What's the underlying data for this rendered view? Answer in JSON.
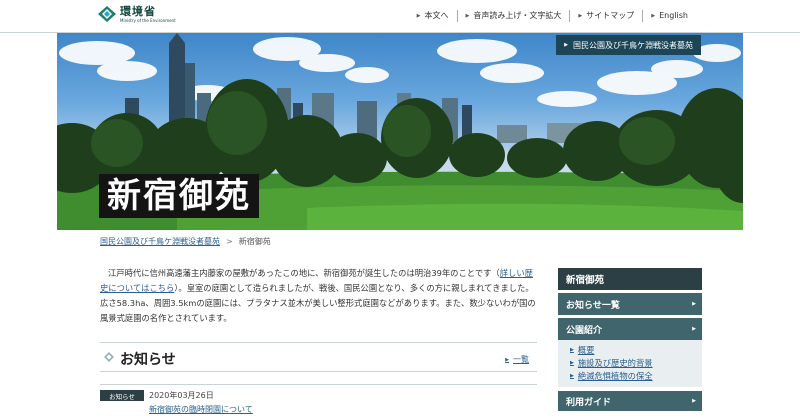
{
  "header": {
    "logo_jp": "環境省",
    "logo_en": "Ministry of the Environment",
    "util_nav": [
      "本文へ",
      "音声読み上げ・文字拡大",
      "サイトマップ",
      "English"
    ]
  },
  "hero": {
    "badge": "国民公園及び千鳥ケ淵戦没者墓苑",
    "title": "新宿御苑"
  },
  "breadcrumb": {
    "parent": "国民公園及び千鳥ケ淵戦没者墓苑",
    "current": "新宿御苑"
  },
  "intro": {
    "text_before": "江戸時代に信州高遠藩主内藤家の屋敷があったこの地に、新宿御苑が誕生したのは明治39年のことです（",
    "link": "詳しい歴史についてはこちら",
    "text_after": "）。皇室の庭園として造られましたが、戦後、国民公園となり、多くの方に親しまれてきました。広さ58.3ha、周囲3.5kmの庭園には、プラタナス並木が美しい整形式庭園などがあります。また、数少ないわが国の風景式庭園の名作とされています。"
  },
  "news": {
    "title": "お知らせ",
    "all_link": "一覧",
    "items": [
      {
        "tag": "お知らせ",
        "date": "2020年03月26日",
        "title": "新宿御苑の臨時閉園について"
      }
    ]
  },
  "sidebar": {
    "head": "新宿御苑",
    "sections": [
      {
        "label": "お知らせ一覧",
        "items": []
      },
      {
        "label": "公園紹介",
        "items": [
          "概要",
          "施設及び歴史的背景",
          "絶滅危惧植物の保全"
        ]
      },
      {
        "label": "利用ガイド",
        "items": []
      }
    ]
  },
  "colors": {
    "dark_teal": "#2b3f45",
    "section_teal": "#41656c",
    "link_blue": "#2a6090"
  },
  "icons": {
    "logo": "moe-logo-icon",
    "news": "diamond-icon",
    "arrow": "arrow-right-icon"
  }
}
